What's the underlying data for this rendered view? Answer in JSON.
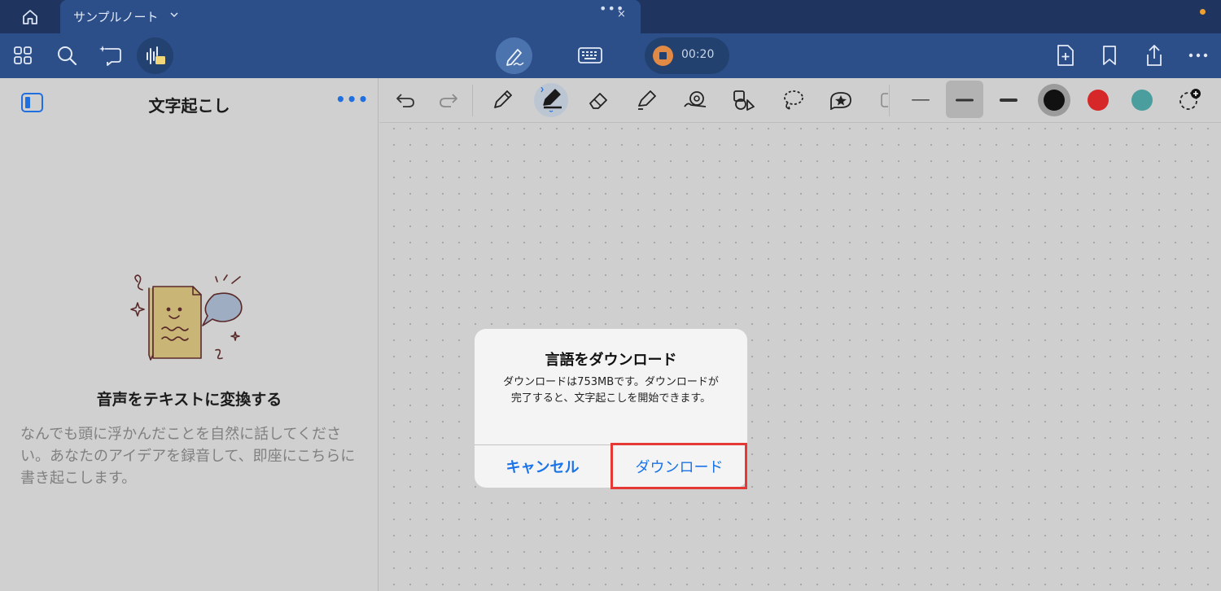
{
  "tabbar": {
    "tab_title": "サンプルノート",
    "tab_more": "•••",
    "tab_close": "×"
  },
  "toolbar": {
    "timer": "00:20",
    "icons": [
      "home-icon",
      "grid-icon",
      "search-icon",
      "lasso-ai-icon",
      "transcribe-icon",
      "pen-mode-icon",
      "keyboard-icon",
      "record-stop-icon",
      "add-page-icon",
      "bookmark-icon",
      "share-icon",
      "more-icon"
    ]
  },
  "sidebar": {
    "title": "文字起こし",
    "more": "•••",
    "heading": "音声をテキストに変換する",
    "body": "なんでも頭に浮かんだことを自然に話してください。あなたのアイデアを録音して、即座にこちらに書き起こします。"
  },
  "pen_toolbar": {
    "colors": [
      "#111111",
      "#d62828",
      "#4a9e9e"
    ],
    "tools": [
      "undo-icon",
      "redo-icon",
      "pencil-icon",
      "pen-icon",
      "eraser-icon",
      "highlighter-icon",
      "shape-icon",
      "element-icon",
      "lasso-icon",
      "sticker-icon"
    ]
  },
  "dialog": {
    "title": "言語をダウンロード",
    "message": "ダウンロードは753MBです。ダウンロードが完了すると、文字起こしを開始できます。",
    "cancel_label": "キャンセル",
    "download_label": "ダウンロード",
    "accent_color": "#1a73e8",
    "highlight_color": "#e53935"
  }
}
